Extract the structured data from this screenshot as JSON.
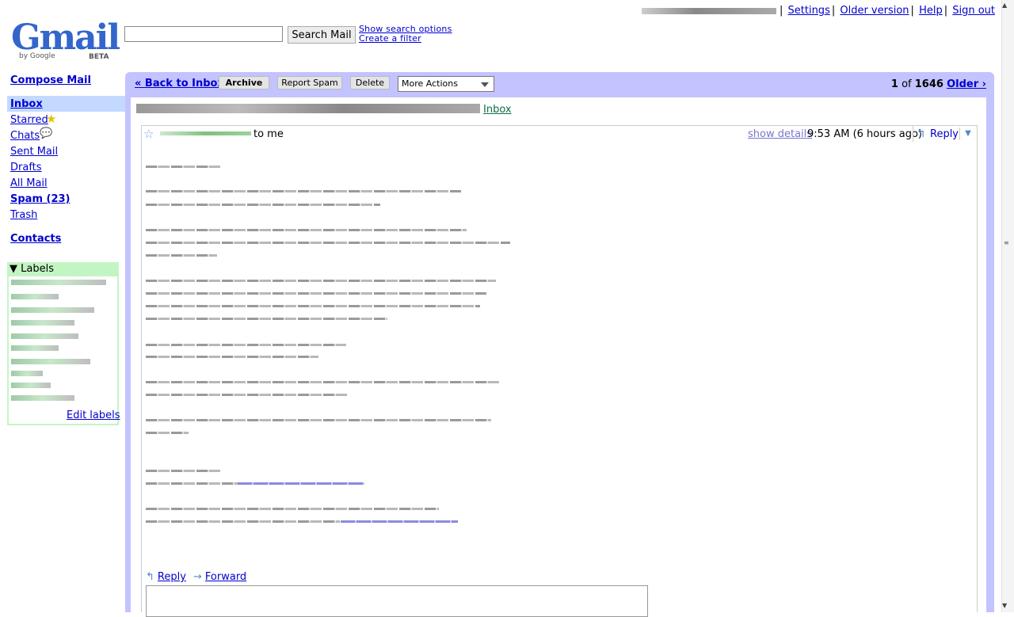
{
  "header": {
    "logo_text": "Gmail",
    "logo_by": "by Google",
    "logo_beta": "BETA",
    "search_button": "Search Mail",
    "search_value": "",
    "show_search_options": "Show search options",
    "create_filter": "Create a filter",
    "top_links": [
      "Settings",
      "Older version",
      "Help",
      "Sign out"
    ]
  },
  "sidebar": {
    "compose": "Compose Mail",
    "items": [
      {
        "label": "Inbox",
        "bold": true,
        "selected": true
      },
      {
        "label": "Starred",
        "icon": "star-icon"
      },
      {
        "label": "Chats",
        "icon": "chat-bubble-icon"
      },
      {
        "label": "Sent Mail"
      },
      {
        "label": "Drafts"
      },
      {
        "label": "All Mail"
      },
      {
        "label": "Spam (23)",
        "bold": true
      },
      {
        "label": "Trash"
      }
    ],
    "contacts": "Contacts",
    "labels_title": "Labels",
    "edit_labels": "Edit labels"
  },
  "toolbar": {
    "back": "« Back to Inbox",
    "archive": "Archive",
    "report_spam": "Report Spam",
    "delete": "Delete",
    "more_actions": "More Actions",
    "pager_current": "1",
    "pager_of": "of",
    "pager_total": "1646",
    "older": "Older ›"
  },
  "message": {
    "inbox_tag": "Inbox",
    "to_me": "to me",
    "show_details": "show details",
    "time": "9:53 AM (6 hours ago)",
    "reply": "Reply",
    "bottom_reply": "Reply",
    "bottom_forward": "Forward"
  },
  "colors": {
    "frame": "#c3c3ff",
    "link": "#0000cc",
    "labels_green": "#c3f5c3",
    "inbox_highlight": "#c3d9ff"
  }
}
